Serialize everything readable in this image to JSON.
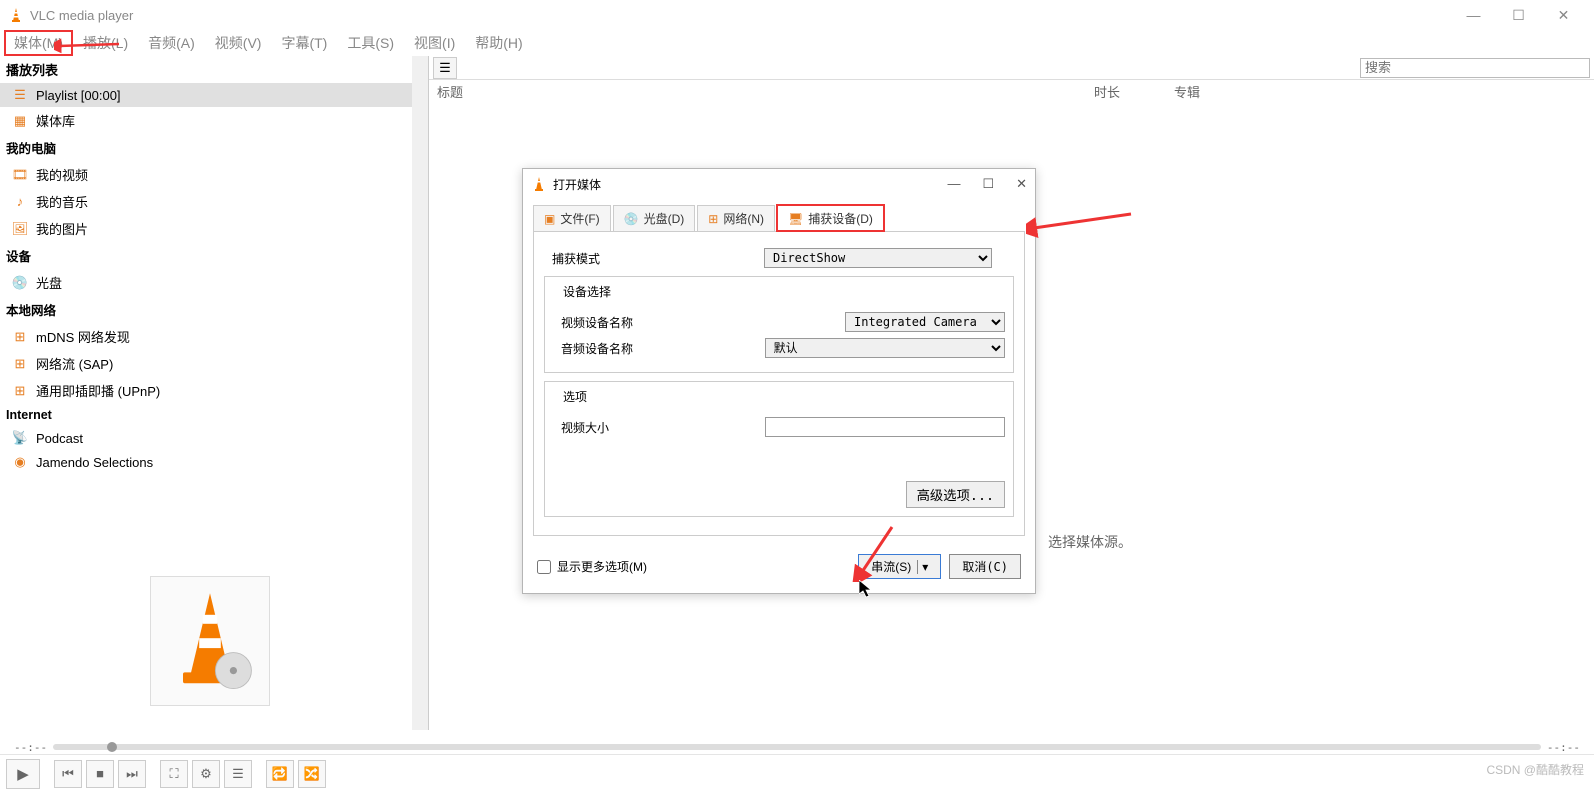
{
  "app": {
    "title": "VLC media player"
  },
  "menu": {
    "items": [
      "媒体(M)",
      "播放(L)",
      "音频(A)",
      "视频(V)",
      "字幕(T)",
      "工具(S)",
      "视图(I)",
      "帮助(H)"
    ]
  },
  "sidebar": {
    "header": "播放列表",
    "groups": [
      {
        "title": null,
        "items": [
          {
            "label": "Playlist [00:00]",
            "selected": true,
            "icon": "list"
          },
          {
            "label": "媒体库",
            "icon": "lib"
          }
        ]
      },
      {
        "title": "我的电脑",
        "items": [
          {
            "label": "我的视频",
            "icon": "video"
          },
          {
            "label": "我的音乐",
            "icon": "music"
          },
          {
            "label": "我的图片",
            "icon": "picture"
          }
        ]
      },
      {
        "title": "设备",
        "items": [
          {
            "label": "光盘",
            "icon": "disc"
          }
        ]
      },
      {
        "title": "本地网络",
        "items": [
          {
            "label": "mDNS 网络发现",
            "icon": "net"
          },
          {
            "label": "网络流 (SAP)",
            "icon": "net"
          },
          {
            "label": "通用即插即播  (UPnP)",
            "icon": "net"
          }
        ]
      },
      {
        "title": "Internet",
        "items": [
          {
            "label": "Podcast",
            "icon": "podcast"
          },
          {
            "label": "Jamendo Selections",
            "icon": "jamendo"
          }
        ]
      }
    ]
  },
  "main": {
    "search_placeholder": "搜索",
    "columns": {
      "title": "标题",
      "duration": "时长",
      "album": "专辑"
    },
    "hint": "选择媒体源。"
  },
  "dialog": {
    "title": "打开媒体",
    "tabs": {
      "file": "文件(F)",
      "disc": "光盘(D)",
      "network": "网络(N)",
      "capture": "捕获设备(D)"
    },
    "capture_mode_label": "捕获模式",
    "capture_mode_value": "DirectShow",
    "device_section": "设备选择",
    "video_device_label": "视频设备名称",
    "video_device_value": "Integrated Camera",
    "audio_device_label": "音频设备名称",
    "audio_device_value": "默认",
    "options_section": "选项",
    "video_size_label": "视频大小",
    "video_size_value": "",
    "advanced_options": "高级选项...",
    "show_more_options": "显示更多选项(M)",
    "stream_button": "串流(S)",
    "cancel_button": "取消(C)"
  },
  "controls": {
    "time_start": "--:--",
    "time_end": "--:--"
  },
  "watermark": "CSDN @酷酷教程"
}
